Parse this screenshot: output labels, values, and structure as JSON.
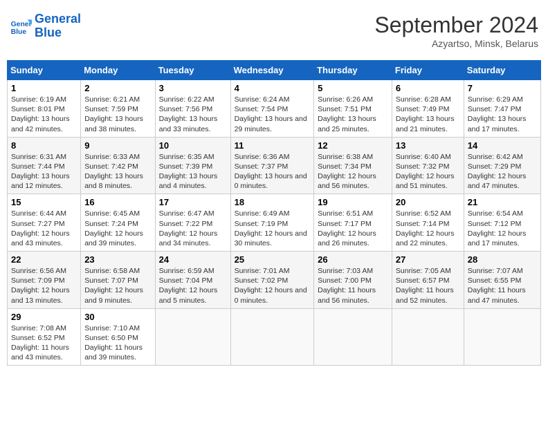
{
  "header": {
    "logo_line1": "General",
    "logo_line2": "Blue",
    "month_title": "September 2024",
    "subtitle": "Azyartso, Minsk, Belarus"
  },
  "weekdays": [
    "Sunday",
    "Monday",
    "Tuesday",
    "Wednesday",
    "Thursday",
    "Friday",
    "Saturday"
  ],
  "weeks": [
    [
      {
        "day": "1",
        "sunrise": "Sunrise: 6:19 AM",
        "sunset": "Sunset: 8:01 PM",
        "daylight": "Daylight: 13 hours and 42 minutes."
      },
      {
        "day": "2",
        "sunrise": "Sunrise: 6:21 AM",
        "sunset": "Sunset: 7:59 PM",
        "daylight": "Daylight: 13 hours and 38 minutes."
      },
      {
        "day": "3",
        "sunrise": "Sunrise: 6:22 AM",
        "sunset": "Sunset: 7:56 PM",
        "daylight": "Daylight: 13 hours and 33 minutes."
      },
      {
        "day": "4",
        "sunrise": "Sunrise: 6:24 AM",
        "sunset": "Sunset: 7:54 PM",
        "daylight": "Daylight: 13 hours and 29 minutes."
      },
      {
        "day": "5",
        "sunrise": "Sunrise: 6:26 AM",
        "sunset": "Sunset: 7:51 PM",
        "daylight": "Daylight: 13 hours and 25 minutes."
      },
      {
        "day": "6",
        "sunrise": "Sunrise: 6:28 AM",
        "sunset": "Sunset: 7:49 PM",
        "daylight": "Daylight: 13 hours and 21 minutes."
      },
      {
        "day": "7",
        "sunrise": "Sunrise: 6:29 AM",
        "sunset": "Sunset: 7:47 PM",
        "daylight": "Daylight: 13 hours and 17 minutes."
      }
    ],
    [
      {
        "day": "8",
        "sunrise": "Sunrise: 6:31 AM",
        "sunset": "Sunset: 7:44 PM",
        "daylight": "Daylight: 13 hours and 12 minutes."
      },
      {
        "day": "9",
        "sunrise": "Sunrise: 6:33 AM",
        "sunset": "Sunset: 7:42 PM",
        "daylight": "Daylight: 13 hours and 8 minutes."
      },
      {
        "day": "10",
        "sunrise": "Sunrise: 6:35 AM",
        "sunset": "Sunset: 7:39 PM",
        "daylight": "Daylight: 13 hours and 4 minutes."
      },
      {
        "day": "11",
        "sunrise": "Sunrise: 6:36 AM",
        "sunset": "Sunset: 7:37 PM",
        "daylight": "Daylight: 13 hours and 0 minutes."
      },
      {
        "day": "12",
        "sunrise": "Sunrise: 6:38 AM",
        "sunset": "Sunset: 7:34 PM",
        "daylight": "Daylight: 12 hours and 56 minutes."
      },
      {
        "day": "13",
        "sunrise": "Sunrise: 6:40 AM",
        "sunset": "Sunset: 7:32 PM",
        "daylight": "Daylight: 12 hours and 51 minutes."
      },
      {
        "day": "14",
        "sunrise": "Sunrise: 6:42 AM",
        "sunset": "Sunset: 7:29 PM",
        "daylight": "Daylight: 12 hours and 47 minutes."
      }
    ],
    [
      {
        "day": "15",
        "sunrise": "Sunrise: 6:44 AM",
        "sunset": "Sunset: 7:27 PM",
        "daylight": "Daylight: 12 hours and 43 minutes."
      },
      {
        "day": "16",
        "sunrise": "Sunrise: 6:45 AM",
        "sunset": "Sunset: 7:24 PM",
        "daylight": "Daylight: 12 hours and 39 minutes."
      },
      {
        "day": "17",
        "sunrise": "Sunrise: 6:47 AM",
        "sunset": "Sunset: 7:22 PM",
        "daylight": "Daylight: 12 hours and 34 minutes."
      },
      {
        "day": "18",
        "sunrise": "Sunrise: 6:49 AM",
        "sunset": "Sunset: 7:19 PM",
        "daylight": "Daylight: 12 hours and 30 minutes."
      },
      {
        "day": "19",
        "sunrise": "Sunrise: 6:51 AM",
        "sunset": "Sunset: 7:17 PM",
        "daylight": "Daylight: 12 hours and 26 minutes."
      },
      {
        "day": "20",
        "sunrise": "Sunrise: 6:52 AM",
        "sunset": "Sunset: 7:14 PM",
        "daylight": "Daylight: 12 hours and 22 minutes."
      },
      {
        "day": "21",
        "sunrise": "Sunrise: 6:54 AM",
        "sunset": "Sunset: 7:12 PM",
        "daylight": "Daylight: 12 hours and 17 minutes."
      }
    ],
    [
      {
        "day": "22",
        "sunrise": "Sunrise: 6:56 AM",
        "sunset": "Sunset: 7:09 PM",
        "daylight": "Daylight: 12 hours and 13 minutes."
      },
      {
        "day": "23",
        "sunrise": "Sunrise: 6:58 AM",
        "sunset": "Sunset: 7:07 PM",
        "daylight": "Daylight: 12 hours and 9 minutes."
      },
      {
        "day": "24",
        "sunrise": "Sunrise: 6:59 AM",
        "sunset": "Sunset: 7:04 PM",
        "daylight": "Daylight: 12 hours and 5 minutes."
      },
      {
        "day": "25",
        "sunrise": "Sunrise: 7:01 AM",
        "sunset": "Sunset: 7:02 PM",
        "daylight": "Daylight: 12 hours and 0 minutes."
      },
      {
        "day": "26",
        "sunrise": "Sunrise: 7:03 AM",
        "sunset": "Sunset: 7:00 PM",
        "daylight": "Daylight: 11 hours and 56 minutes."
      },
      {
        "day": "27",
        "sunrise": "Sunrise: 7:05 AM",
        "sunset": "Sunset: 6:57 PM",
        "daylight": "Daylight: 11 hours and 52 minutes."
      },
      {
        "day": "28",
        "sunrise": "Sunrise: 7:07 AM",
        "sunset": "Sunset: 6:55 PM",
        "daylight": "Daylight: 11 hours and 47 minutes."
      }
    ],
    [
      {
        "day": "29",
        "sunrise": "Sunrise: 7:08 AM",
        "sunset": "Sunset: 6:52 PM",
        "daylight": "Daylight: 11 hours and 43 minutes."
      },
      {
        "day": "30",
        "sunrise": "Sunrise: 7:10 AM",
        "sunset": "Sunset: 6:50 PM",
        "daylight": "Daylight: 11 hours and 39 minutes."
      },
      null,
      null,
      null,
      null,
      null
    ]
  ]
}
